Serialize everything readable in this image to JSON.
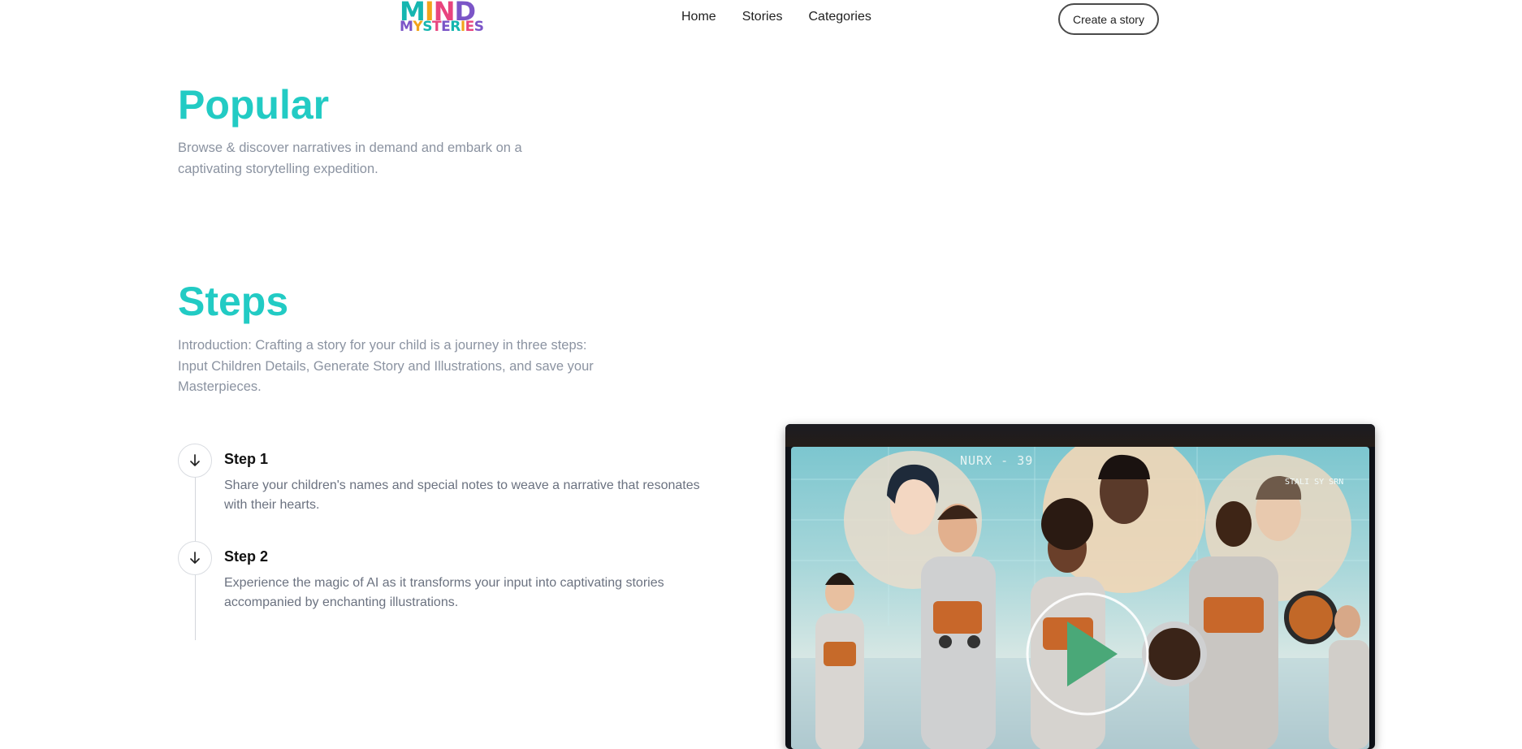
{
  "header": {
    "logo_top": "MIND",
    "logo_bottom": "MYSTERIES",
    "nav": [
      "Home",
      "Stories",
      "Categories"
    ],
    "create_label": "Create a story"
  },
  "popular": {
    "title": "Popular",
    "description": "Browse & discover narratives in demand and embark on a captivating storytelling expedition."
  },
  "steps": {
    "title": "Steps",
    "description": "Introduction: Crafting a story for your child is a journey in three steps: Input Children Details, Generate Story and Illustrations, and save your Masterpieces.",
    "items": [
      {
        "title": "Step 1",
        "text": "Share your children's names and special notes to weave a narrative that resonates with their hearts."
      },
      {
        "title": "Step 2",
        "text": "Experience the magic of AI as it transforms your input into captivating stories accompanied by enchanting illustrations."
      }
    ]
  },
  "video": {
    "hud_label": "NURX - 39",
    "hud_right": "STALI SY SRN",
    "play_icon": "play-icon"
  },
  "colors": {
    "accent": "#22cbc4",
    "muted_text": "#8b93a1",
    "play_green": "#4aa878"
  }
}
